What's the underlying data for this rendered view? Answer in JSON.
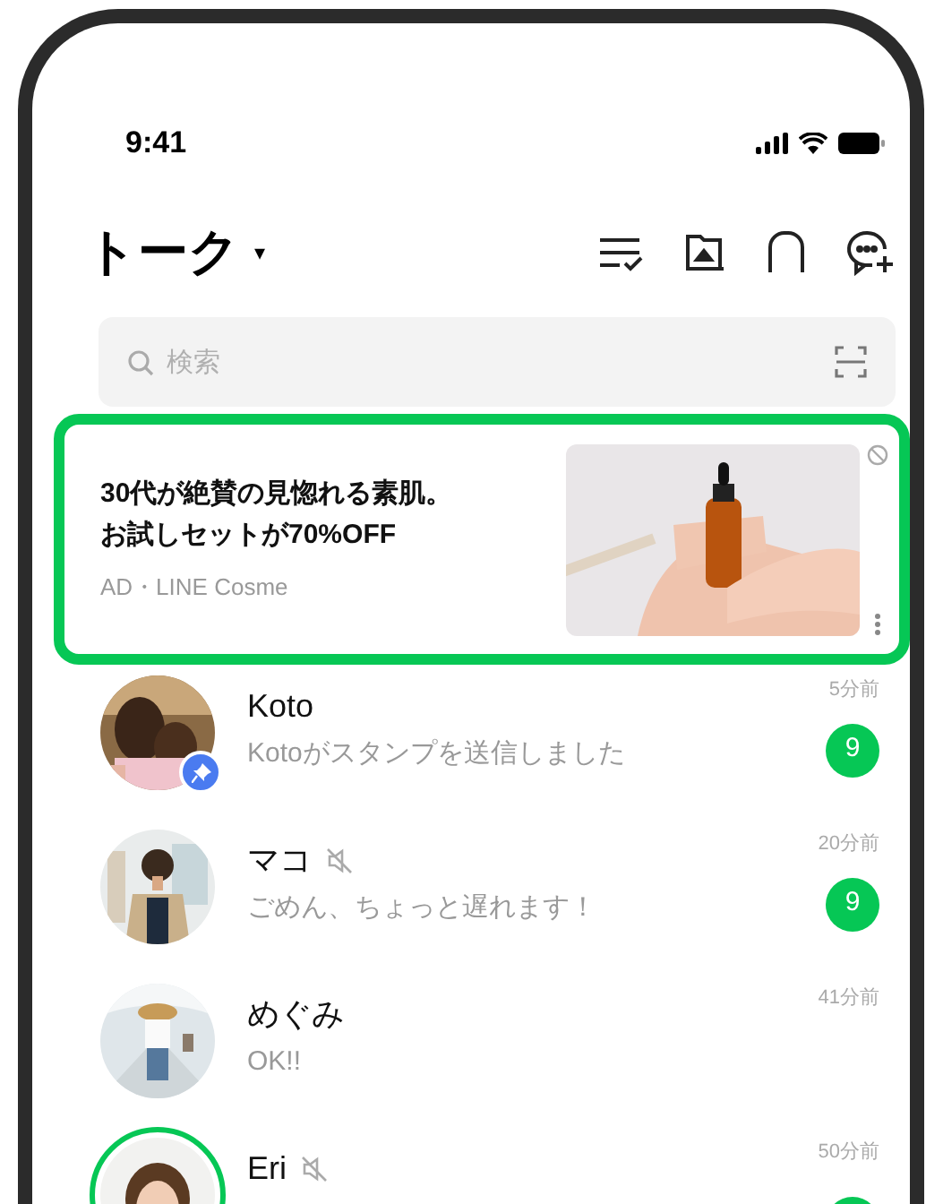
{
  "status_bar": {
    "time": "9:41"
  },
  "header": {
    "title": "トーク",
    "caret": "▾"
  },
  "search": {
    "placeholder": "検索"
  },
  "ad": {
    "headline": [
      "30代が絶賛の見惚れる素肌。",
      "お試しセットが70%OFF"
    ],
    "source": "AD・LINE Cosme"
  },
  "chats": [
    {
      "name": "Koto",
      "message": "Kotoがスタンプを送信しました",
      "time": "5分前",
      "badge": "9",
      "muted": false,
      "pinned": true,
      "story": false
    },
    {
      "name": "マコ",
      "message": "ごめん、ちょっと遅れます！",
      "time": "20分前",
      "badge": "9",
      "muted": true,
      "pinned": false,
      "story": false
    },
    {
      "name": "めぐみ",
      "message": "OK!!",
      "time": "41分前",
      "muted": false,
      "pinned": false,
      "story": false
    },
    {
      "name": "Eri",
      "time": "50分前",
      "unread": true,
      "muted": true,
      "pinned": false,
      "story": true
    }
  ]
}
